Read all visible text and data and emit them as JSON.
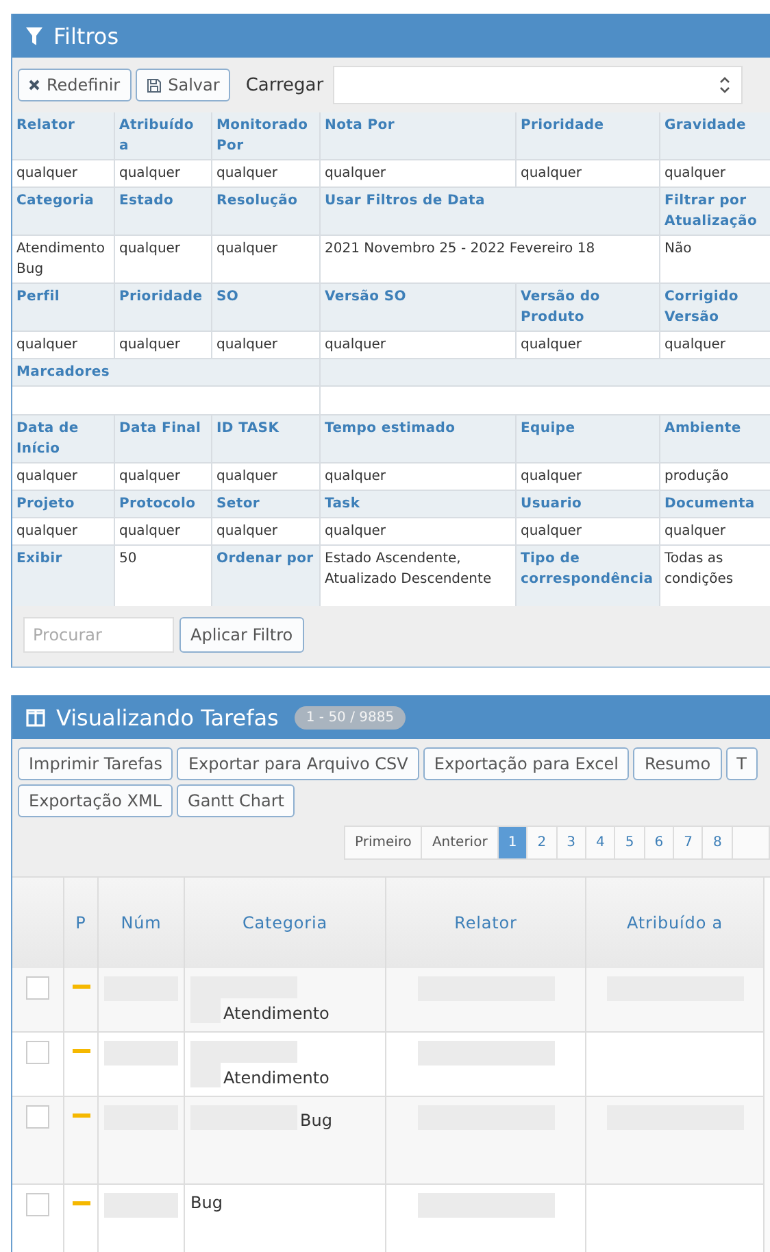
{
  "filters": {
    "title": "Filtros",
    "reset": "Redefinir",
    "save": "Salvar",
    "load_label": "Carregar",
    "rows": [
      {
        "cells": [
          {
            "kind": "label",
            "text": "Relator"
          },
          {
            "kind": "label",
            "text": "Atribuído a"
          },
          {
            "kind": "label",
            "text": "Monitorado Por"
          },
          {
            "kind": "label",
            "text": "Nota Por"
          },
          {
            "kind": "label",
            "text": "Prioridade"
          },
          {
            "kind": "label",
            "text": "Gravidade"
          }
        ]
      },
      {
        "cells": [
          {
            "kind": "value",
            "text": "qualquer"
          },
          {
            "kind": "value",
            "text": "qualquer"
          },
          {
            "kind": "value",
            "text": "qualquer"
          },
          {
            "kind": "value",
            "text": "qualquer"
          },
          {
            "kind": "value",
            "text": "qualquer"
          },
          {
            "kind": "value",
            "text": "qualquer"
          }
        ]
      },
      {
        "cells": [
          {
            "kind": "label",
            "text": "Categoria"
          },
          {
            "kind": "label",
            "text": "Estado"
          },
          {
            "kind": "label",
            "text": "Resolução"
          },
          {
            "kind": "label-wide",
            "text": "Usar Filtros de Data"
          },
          {
            "kind": "label",
            "text": "Filtrar por\nAtualização"
          }
        ]
      },
      {
        "cells": [
          {
            "kind": "value",
            "text": "Atendimento\nBug"
          },
          {
            "kind": "value",
            "text": "qualquer"
          },
          {
            "kind": "value",
            "text": "qualquer"
          },
          {
            "kind": "value-wide",
            "text": "2021 Novembro 25 - 2022 Fevereiro 18"
          },
          {
            "kind": "value",
            "text": "Não"
          }
        ]
      },
      {
        "cells": [
          {
            "kind": "label",
            "text": "Perfil"
          },
          {
            "kind": "label",
            "text": "Prioridade"
          },
          {
            "kind": "label",
            "text": "SO"
          },
          {
            "kind": "label",
            "text": "Versão SO"
          },
          {
            "kind": "label",
            "text": "Versão do Produto"
          },
          {
            "kind": "label",
            "text": "Corrigido\nVersão"
          }
        ]
      },
      {
        "cells": [
          {
            "kind": "value",
            "text": "qualquer"
          },
          {
            "kind": "value",
            "text": "qualquer"
          },
          {
            "kind": "value",
            "text": "qualquer"
          },
          {
            "kind": "value",
            "text": "qualquer"
          },
          {
            "kind": "value",
            "text": "qualquer"
          },
          {
            "kind": "value",
            "text": "qualquer"
          }
        ]
      },
      {
        "kind": "tags",
        "label": "Marcadores"
      },
      {
        "cells": [
          {
            "kind": "label",
            "text": "Data de Início"
          },
          {
            "kind": "label",
            "text": "Data Final"
          },
          {
            "kind": "label",
            "text": "ID TASK"
          },
          {
            "kind": "label",
            "text": "Tempo estimado"
          },
          {
            "kind": "label",
            "text": "Equipe"
          },
          {
            "kind": "label",
            "text": "Ambiente"
          }
        ]
      },
      {
        "cells": [
          {
            "kind": "value",
            "text": "qualquer"
          },
          {
            "kind": "value",
            "text": "qualquer"
          },
          {
            "kind": "value",
            "text": "qualquer"
          },
          {
            "kind": "value",
            "text": "qualquer"
          },
          {
            "kind": "value",
            "text": "qualquer"
          },
          {
            "kind": "value",
            "text": "produção"
          }
        ]
      },
      {
        "cells": [
          {
            "kind": "label",
            "text": "Projeto"
          },
          {
            "kind": "label",
            "text": "Protocolo"
          },
          {
            "kind": "label",
            "text": "Setor"
          },
          {
            "kind": "label",
            "text": "Task"
          },
          {
            "kind": "label",
            "text": "Usuario"
          },
          {
            "kind": "label",
            "text": "Documenta"
          }
        ]
      },
      {
        "cells": [
          {
            "kind": "value",
            "text": "qualquer"
          },
          {
            "kind": "value",
            "text": "qualquer"
          },
          {
            "kind": "value",
            "text": "qualquer"
          },
          {
            "kind": "value",
            "text": "qualquer"
          },
          {
            "kind": "value",
            "text": "qualquer"
          },
          {
            "kind": "value",
            "text": "qualquer"
          }
        ]
      },
      {
        "cells": [
          {
            "kind": "label",
            "text": "Exibir"
          },
          {
            "kind": "value",
            "text": "50"
          },
          {
            "kind": "label",
            "text": "Ordenar por"
          },
          {
            "kind": "value",
            "text": "Estado Ascendente,\nAtualizado Descendente"
          },
          {
            "kind": "label",
            "text": "Tipo de correspondência"
          },
          {
            "kind": "value",
            "text": "Todas as condições"
          }
        ]
      }
    ],
    "search": {
      "placeholder": "Procurar"
    },
    "apply": "Aplicar Filtro"
  },
  "tasks": {
    "title": "Visualizando Tarefas",
    "count": "1 - 50 / 9885",
    "actions": [
      "Imprimir Tarefas",
      "Exportar para Arquivo CSV",
      "Exportação para Excel",
      "Resumo",
      "T",
      "Exportação XML",
      "Gantt Chart"
    ],
    "pages": [
      {
        "label": "Primeiro",
        "selected": false
      },
      {
        "label": "Anterior",
        "selected": false
      },
      {
        "label": "1",
        "selected": true
      },
      {
        "label": "2",
        "selected": false
      },
      {
        "label": "3",
        "selected": false
      },
      {
        "label": "4",
        "selected": false
      },
      {
        "label": "5",
        "selected": false
      },
      {
        "label": "6",
        "selected": false
      },
      {
        "label": "7",
        "selected": false
      },
      {
        "label": "8",
        "selected": false
      }
    ],
    "columns": [
      "P",
      "Núm",
      "Categoria",
      "Relator",
      "Atribuído a"
    ],
    "rows": [
      {
        "kind": "stacked",
        "checked": false,
        "category": "Atendimento",
        "assigned_shown": true
      },
      {
        "kind": "stacked",
        "checked": false,
        "category": "Atendimento",
        "assigned_shown": false
      },
      {
        "kind": "inline",
        "checked": false,
        "category": "Bug",
        "assigned_shown": true
      },
      {
        "kind": "plain",
        "checked": false,
        "category": "Bug",
        "assigned_shown": false
      }
    ]
  }
}
